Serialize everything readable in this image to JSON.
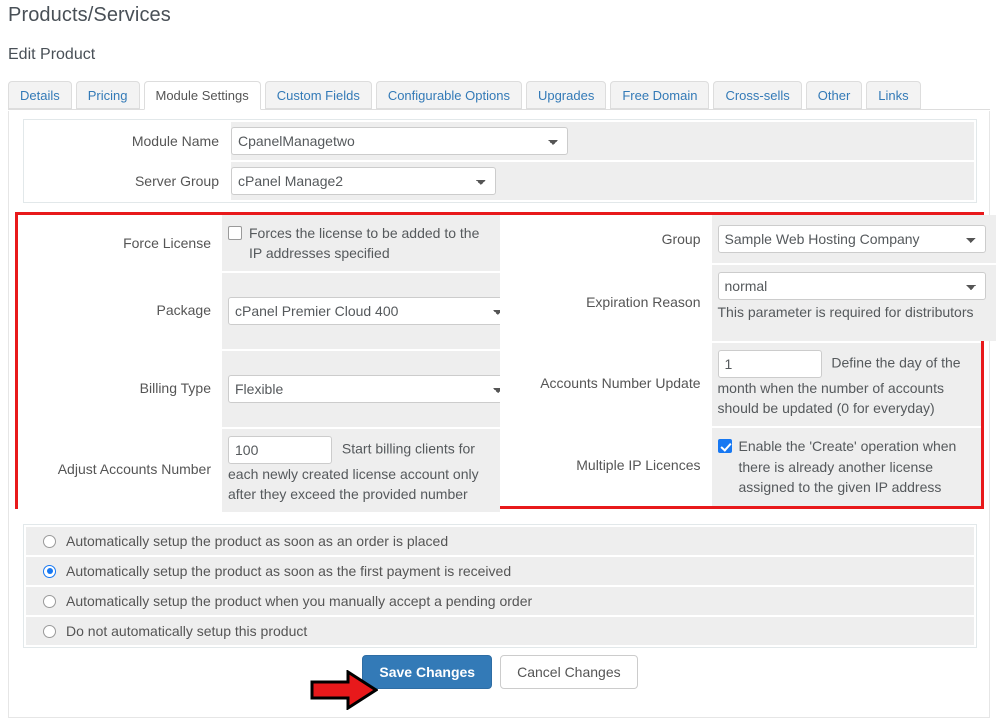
{
  "page": {
    "title": "Products/Services",
    "subtitle": "Edit Product"
  },
  "tabs": [
    {
      "label": "Details",
      "active": false
    },
    {
      "label": "Pricing",
      "active": false
    },
    {
      "label": "Module Settings",
      "active": true
    },
    {
      "label": "Custom Fields",
      "active": false
    },
    {
      "label": "Configurable Options",
      "active": false
    },
    {
      "label": "Upgrades",
      "active": false
    },
    {
      "label": "Free Domain",
      "active": false
    },
    {
      "label": "Cross-sells",
      "active": false
    },
    {
      "label": "Other",
      "active": false
    },
    {
      "label": "Links",
      "active": false
    }
  ],
  "module_panel": {
    "module_name": {
      "label": "Module Name",
      "value": "CpanelManagetwo"
    },
    "server_group": {
      "label": "Server Group",
      "value": "cPanel Manage2"
    }
  },
  "settings": {
    "highlight_color": "#e8191b",
    "left": {
      "force_license": {
        "label": "Force License",
        "checkbox_text": "Forces the license to be added to the IP addresses specified",
        "checked": false
      },
      "package": {
        "label": "Package",
        "value": "cPanel Premier Cloud 400"
      },
      "billing_type": {
        "label": "Billing Type",
        "value": "Flexible"
      },
      "adjust_accounts_number": {
        "label": "Adjust Accounts Number",
        "value": "100",
        "help": "Start billing clients for each newly created license account only after they exceed the provided number"
      }
    },
    "right": {
      "group": {
        "label": "Group",
        "value": "Sample Web Hosting Company"
      },
      "expiration_reason": {
        "label": "Expiration Reason",
        "value": "normal",
        "help": "This parameter is required for distributors"
      },
      "accounts_number_update": {
        "label": "Accounts Number Update",
        "value": "1",
        "help": "Define the day of the month when the number of accounts should be updated (0 for everyday)"
      },
      "multiple_ip_licences": {
        "label": "Multiple IP Licences",
        "checkbox_text": "Enable the 'Create' operation when there is already another license assigned to the given IP address",
        "checked": true
      }
    }
  },
  "autosetup_options": [
    {
      "label": "Automatically setup the product as soon as an order is placed",
      "selected": false
    },
    {
      "label": "Automatically setup the product as soon as the first payment is received",
      "selected": true
    },
    {
      "label": "Automatically setup the product when you manually accept a pending order",
      "selected": false
    },
    {
      "label": "Do not automatically setup this product",
      "selected": false
    }
  ],
  "footer": {
    "save_label": "Save Changes",
    "cancel_label": "Cancel Changes",
    "arrow_color": "#e8191b"
  }
}
